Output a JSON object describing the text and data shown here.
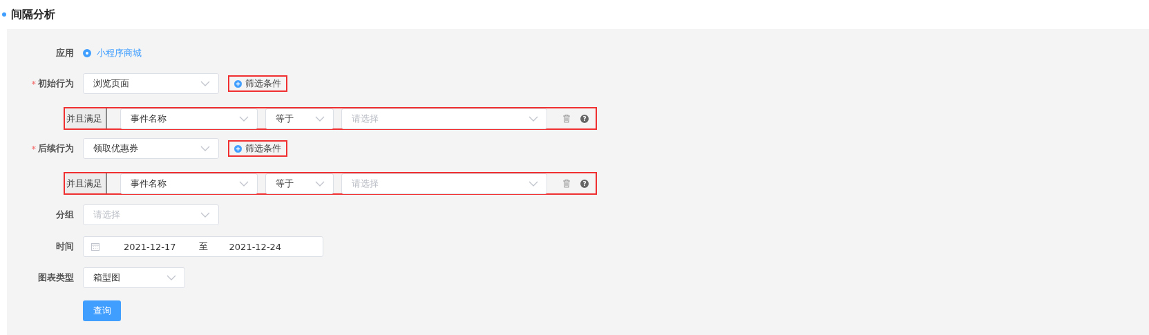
{
  "page": {
    "title": "间隔分析"
  },
  "app": {
    "label": "应用",
    "options": [
      {
        "label": "小程序商城",
        "selected": true
      }
    ]
  },
  "behaviors": [
    {
      "label": "初始行为",
      "required_mark": "*",
      "value": "浏览页面",
      "filter_button": {
        "label": "筛选条件",
        "highlighted": true
      },
      "condition": {
        "logic": "并且满足",
        "field": "事件名称",
        "operator": "等于",
        "placeholder": "请选择",
        "help": "?",
        "highlighted": true
      }
    },
    {
      "label": "后续行为",
      "required_mark": "*",
      "value": "领取优惠券",
      "filter_button": {
        "label": "筛选条件",
        "highlighted": true
      },
      "condition": {
        "logic": "并且满足",
        "field": "事件名称",
        "operator": "等于",
        "placeholder": "请选择",
        "help": "?",
        "highlighted": true
      }
    }
  ],
  "group": {
    "label": "分组",
    "placeholder": "请选择"
  },
  "time": {
    "label": "时间",
    "start": "2021-12-17",
    "separator": "至",
    "end": "2021-12-24"
  },
  "chart_type": {
    "label": "图表类型",
    "value": "箱型图"
  },
  "query_button": {
    "label": "查询"
  }
}
